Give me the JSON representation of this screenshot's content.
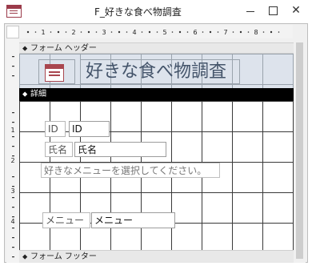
{
  "window": {
    "title": "F_好きな食べ物調査",
    "icon": "form-icon",
    "controls": [
      "minimize",
      "maximize",
      "close"
    ]
  },
  "ruler": {
    "horizontal_ticks": [
      "1",
      "2",
      "3",
      "4",
      "5",
      "6",
      "7",
      "8"
    ],
    "vertical_ticks_detail": [
      "1",
      "2",
      "3",
      "4"
    ]
  },
  "sections": {
    "header_label": "フォーム ヘッダー",
    "detail_label": "詳細",
    "footer_label": "フォーム フッター"
  },
  "header": {
    "title": "好きな食べ物調査"
  },
  "detail": {
    "id_label": "ID",
    "id_field": "ID",
    "name_label": "氏名",
    "name_field": "氏名",
    "instruction": "好きなメニューを選択してください。",
    "menu_label": "メニュー",
    "menu_field": "メニュー"
  },
  "colors": {
    "detail_bar": "#000000",
    "header_background": "#dde3ec",
    "title_text": "#44546a",
    "icon_accent": "#a9464f"
  }
}
